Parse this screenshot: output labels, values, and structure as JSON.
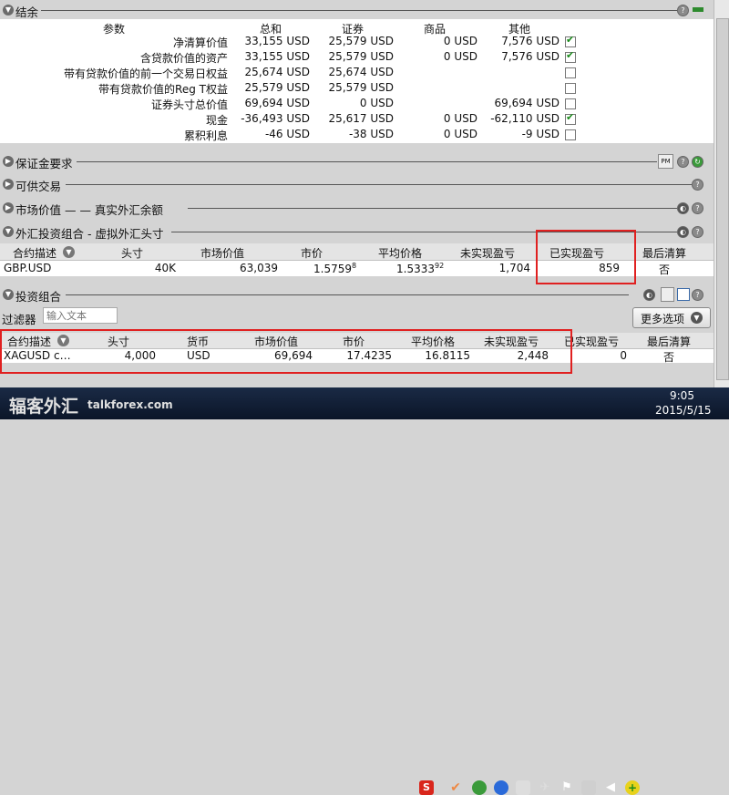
{
  "summary": {
    "title": "结余",
    "columns": [
      "参数",
      "总和",
      "证券",
      "商品",
      "其他"
    ],
    "rows": [
      {
        "label": "净清算价值",
        "total": "33,155 USD",
        "securities": "25,579 USD",
        "commodities": "0 USD",
        "other": "7,576 USD",
        "checked": true,
        "has_check": true
      },
      {
        "label": "含贷款价值的资产",
        "total": "33,155 USD",
        "securities": "25,579 USD",
        "commodities": "0 USD",
        "other": "7,576 USD",
        "checked": true,
        "has_check": true
      },
      {
        "label": "带有贷款价值的前一个交易日权益",
        "total": "25,674 USD",
        "securities": "25,674 USD",
        "commodities": "",
        "other": "",
        "checked": false,
        "has_check": true
      },
      {
        "label": "带有贷款价值的Reg T权益",
        "total": "25,579 USD",
        "securities": "25,579 USD",
        "commodities": "",
        "other": "",
        "checked": false,
        "has_check": true
      },
      {
        "label": "证券头寸总价值",
        "total": "69,694 USD",
        "securities": "0 USD",
        "commodities": "",
        "other": "69,694 USD",
        "checked": false,
        "has_check": true
      },
      {
        "label": "现金",
        "total": "-36,493 USD",
        "securities": "25,617 USD",
        "commodities": "0 USD",
        "other": "-62,110 USD",
        "checked": true,
        "has_check": true
      },
      {
        "label": "累积利息",
        "total": "-46 USD",
        "securities": "-38 USD",
        "commodities": "0 USD",
        "other": "-9 USD",
        "checked": false,
        "has_check": true
      }
    ]
  },
  "sections": {
    "margin": "保证金要求",
    "available": "可供交易",
    "market_value": "市场价值 — — 真实外汇余额",
    "fx_portfolio": "外汇投资组合 - 虚拟外汇头寸",
    "portfolio": "投资组合"
  },
  "fx_table": {
    "columns": [
      "合约描述",
      "头寸",
      "市场价值",
      "市价",
      "平均价格",
      "未实现盈亏",
      "已实现盈亏",
      "最后清算"
    ],
    "row": {
      "contract": "GBP.USD",
      "position": "40K",
      "market_value": "63,039",
      "price": "1.5759",
      "price_sup": "8",
      "avg_price": "1.5333",
      "avg_sup": "92",
      "unrealized": "1,704",
      "realized": "859",
      "last_liq": "否"
    }
  },
  "filter": {
    "label": "过滤器",
    "placeholder": "输入文本",
    "more_options": "更多选项"
  },
  "portfolio_table": {
    "columns": [
      "合约描述",
      "头寸",
      "货币",
      "市场价值",
      "市价",
      "平均价格",
      "未实现盈亏",
      "已实现盈亏",
      "最后清算"
    ],
    "row": {
      "contract": "XAGUSD c…",
      "position": "4,000",
      "currency": "USD",
      "market_value": "69,694",
      "price": "17.4235",
      "avg_price": "16.8115",
      "unrealized": "2,448",
      "realized": "0",
      "last_liq": "否"
    }
  },
  "taskbar": {
    "watermark": "辐客外汇",
    "watermark_site": "talkforex.com",
    "time": "9:05",
    "date": "2015/5/15"
  },
  "colors": {
    "accent_red": "#e02020",
    "check_green": "#1a8a1a",
    "taskbar": "#0b1528"
  }
}
